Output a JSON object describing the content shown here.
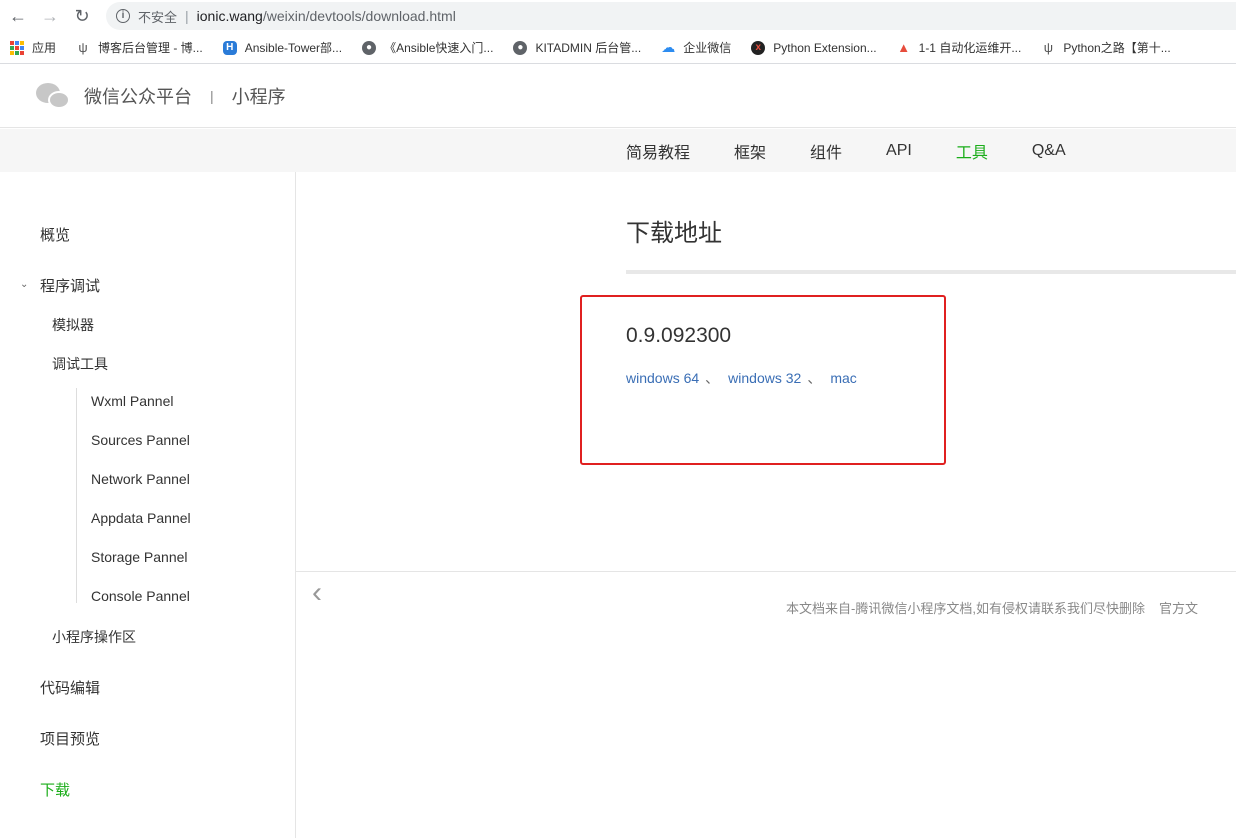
{
  "browser": {
    "insecure_label": "不安全",
    "url_host": "ionic.wang",
    "url_path": "/weixin/devtools/download.html"
  },
  "bookmarks": [
    {
      "label": "应用",
      "icon": "apps-icon",
      "color": "#4285f4"
    },
    {
      "label": "博客后台管理 - 博...",
      "icon": "blog-icon",
      "color": "#555555"
    },
    {
      "label": "Ansible-Tower部...",
      "icon": "hexagon-h-icon",
      "color": "#2a7bd8"
    },
    {
      "label": "《Ansible快速入门...",
      "icon": "globe-icon",
      "color": "#5f6368"
    },
    {
      "label": "KITADMIN 后台管...",
      "icon": "globe-icon",
      "color": "#5f6368"
    },
    {
      "label": "企业微信",
      "icon": "wecom-icon",
      "color": "#2d8cf0"
    },
    {
      "label": "Python Extension...",
      "icon": "x-badge-icon",
      "color": "#c0392b"
    },
    {
      "label": "1-1 自动化运维开...",
      "icon": "flame-icon",
      "color": "#e74c3c"
    },
    {
      "label": "Python之路【第十...",
      "icon": "blog-icon",
      "color": "#555555"
    }
  ],
  "header": {
    "brand": "微信公众平台",
    "separator": "|",
    "subtitle": "小程序"
  },
  "topnav": [
    {
      "label": "简易教程",
      "active": false
    },
    {
      "label": "框架",
      "active": false
    },
    {
      "label": "组件",
      "active": false
    },
    {
      "label": "API",
      "active": false
    },
    {
      "label": "工具",
      "active": true
    },
    {
      "label": "Q&A",
      "active": false
    }
  ],
  "sidebar": {
    "overview": "概览",
    "debug": "程序调试",
    "simulator": "模拟器",
    "debug_tools": "调试工具",
    "panels": [
      "Wxml Pannel",
      "Sources Pannel",
      "Network Pannel",
      "Appdata Pannel",
      "Storage Pannel",
      "Console Pannel"
    ],
    "operation_area": "小程序操作区",
    "code_edit": "代码编辑",
    "project_preview": "项目预览",
    "download": "下载"
  },
  "main": {
    "title": "下载地址",
    "version": "0.9.092300",
    "links": [
      "windows 64",
      "windows 32",
      "mac"
    ],
    "link_separator": "、"
  },
  "footer": {
    "notice": "本文档来自-腾讯微信小程序文档,如有侵权请联系我们尽快删除",
    "official": "官方文"
  },
  "colors": {
    "accent_green": "#1aad19",
    "link_blue": "#3a6eb5",
    "highlight_red": "#e02020"
  }
}
